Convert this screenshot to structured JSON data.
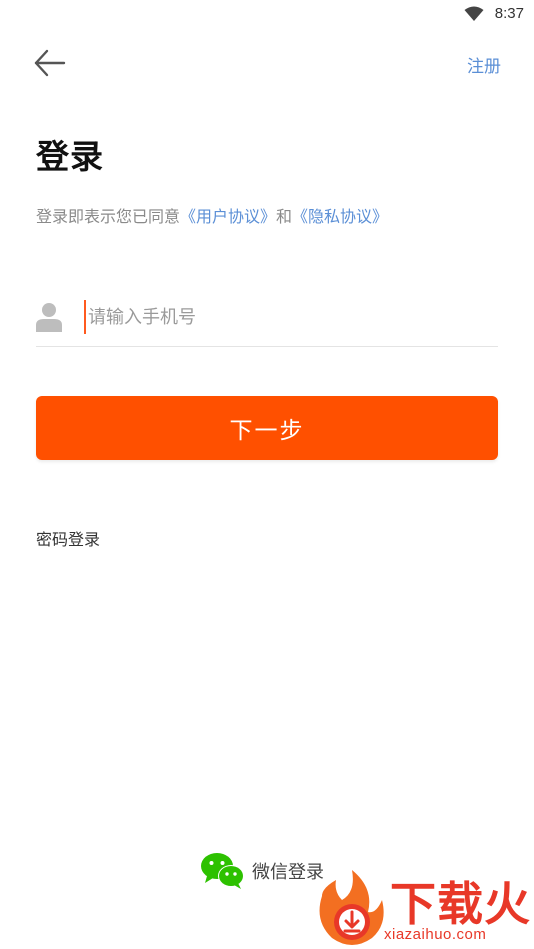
{
  "status_bar": {
    "time": "8:37",
    "wifi_icon": "wifi-icon"
  },
  "header": {
    "back_icon": "arrow-left-icon",
    "register_label": "注册"
  },
  "title": "登录",
  "agreement": {
    "prefix": "登录即表示您已同意",
    "user_agreement": "《用户协议》",
    "conjunction": "和",
    "privacy_policy": "《隐私协议》"
  },
  "phone_field": {
    "icon": "user-icon",
    "placeholder": "请输入手机号",
    "value": ""
  },
  "next_button": {
    "label": "下一步"
  },
  "password_login": {
    "label": "密码登录"
  },
  "wechat_login": {
    "icon": "wechat-icon",
    "label": "微信登录"
  },
  "watermark": {
    "brand": "下载火",
    "url": "xiazaihuo.com"
  },
  "colors": {
    "primary": "#ff5000",
    "link": "#5b8fd6",
    "wechat": "#2dc100"
  }
}
